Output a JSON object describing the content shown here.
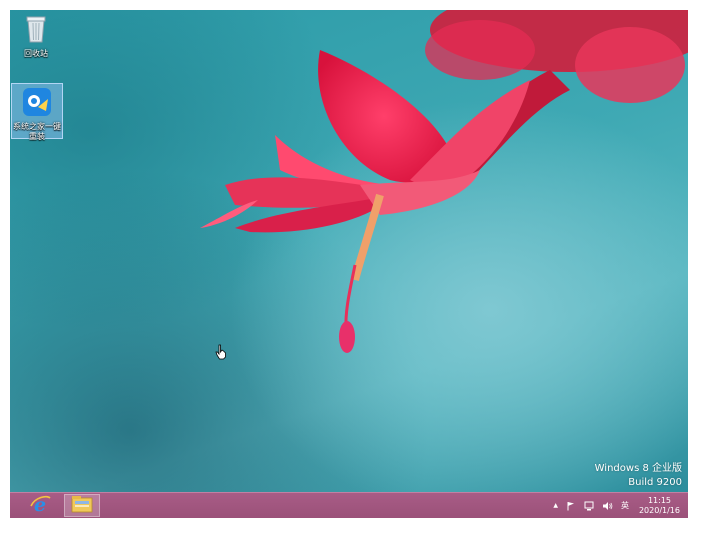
{
  "desktop": {
    "icons": [
      {
        "id": "recycle-bin",
        "label": "回收站",
        "icon": "recycle-bin-icon"
      },
      {
        "id": "onekey",
        "label": "系统之家一键重装",
        "icon": "onekey-reinstall-icon",
        "selected": true
      }
    ],
    "watermark": {
      "line1": "Windows 8 企业版",
      "line2": "Build 9200"
    }
  },
  "taskbar": {
    "pinned": [
      {
        "name": "Internet Explorer",
        "icon": "internet-explorer-icon"
      },
      {
        "name": "File Explorer",
        "icon": "file-explorer-icon",
        "active": true
      }
    ],
    "tray": {
      "chevron": "▲",
      "action_center_icon": "flag-icon",
      "network_icon": "network-icon",
      "volume_icon": "speaker-icon",
      "input_method": "英",
      "time": "11:15",
      "date": "2020/1/16"
    },
    "colors": {
      "background": "#9b5179"
    }
  }
}
